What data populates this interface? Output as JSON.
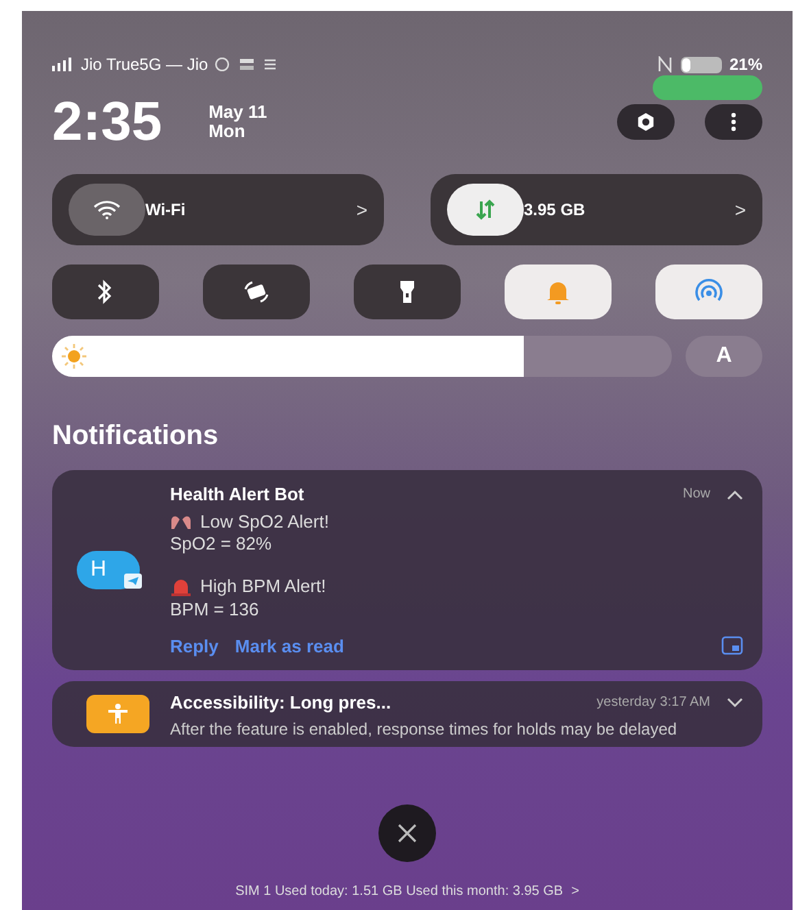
{
  "status_bar": {
    "carrier": "Jio True5G — Jio",
    "battery_percent": "21%"
  },
  "clock": {
    "time": "2:35",
    "date": "May 11",
    "weekday": "Mon"
  },
  "tiles": [
    {
      "kind": "wifi",
      "label": "Wi-Fi",
      "on": false,
      "chevron": ">"
    },
    {
      "kind": "data",
      "label": "3.95 GB",
      "on": true,
      "chevron": ">"
    }
  ],
  "toggles": [
    {
      "kind": "bluetooth",
      "on": false
    },
    {
      "kind": "rotate",
      "on": false
    },
    {
      "kind": "flashlight",
      "on": false
    },
    {
      "kind": "bell",
      "on": true
    },
    {
      "kind": "hotspot",
      "on": true
    }
  ],
  "brightness": {
    "level": 0.76,
    "auto_label": "A"
  },
  "notifications_heading": "Notifications",
  "notifications": [
    {
      "kind": "message",
      "avatar_letter": "H",
      "title": "Health Alert Bot",
      "time": "Now",
      "expanded": true,
      "alerts": [
        {
          "kind": "lungs",
          "headline": "Low SpO2 Alert!",
          "detail": "SpO2 = 82%"
        },
        {
          "kind": "siren",
          "headline": "High BPM Alert!",
          "detail": "BPM = 136"
        }
      ],
      "actions": [
        "Reply",
        "Mark as read"
      ]
    },
    {
      "kind": "accessibility",
      "title": "Accessibility: Long pres...",
      "time": "yesterday 3:17 AM",
      "expanded": false,
      "body": "After the feature is enabled, response times for holds may be delayed"
    }
  ],
  "footer": {
    "text": "SIM 1 Used today: 1.51 GB  Used this month: 3.95 GB",
    "chevron": ">"
  }
}
